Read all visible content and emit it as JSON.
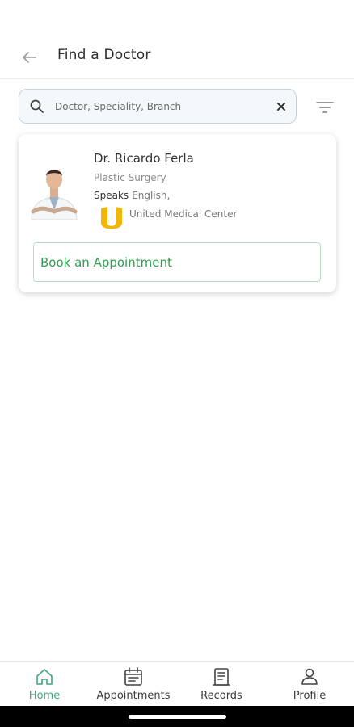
{
  "header": {
    "title": "Find a Doctor",
    "back_icon": "arrow-left-icon"
  },
  "search": {
    "placeholder": "Doctor, Speciality, Branch",
    "value": ""
  },
  "doctors": [
    {
      "name": "Dr. Ricardo Ferla",
      "speciality": "Plastic Surgery",
      "speaks_label": "Speaks",
      "languages": "English,",
      "center": "United Medical Center",
      "book_label": "Book an Appointment"
    }
  ],
  "nav": [
    {
      "label": "Home",
      "icon": "home-icon",
      "active": true
    },
    {
      "label": "Appointments",
      "icon": "calendar-icon",
      "active": false
    },
    {
      "label": "Records",
      "icon": "document-icon",
      "active": false
    },
    {
      "label": "Profile",
      "icon": "user-icon",
      "active": false
    }
  ],
  "colors": {
    "accent": "#3fa67a",
    "book_text": "#2e9e4f",
    "logo": "#f2b705"
  }
}
